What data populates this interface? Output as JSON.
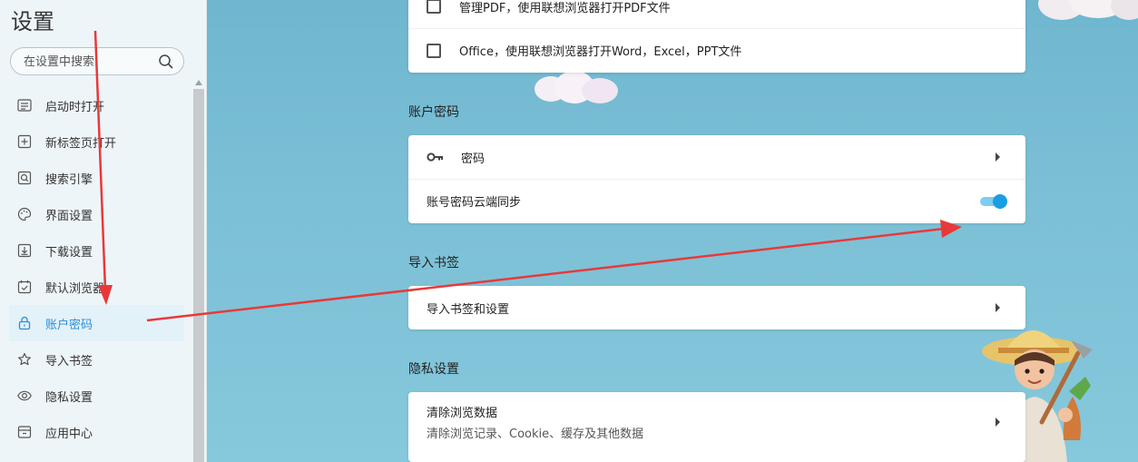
{
  "sidebar": {
    "title": "设置",
    "search_placeholder": "在设置中搜索",
    "items": [
      {
        "label": "启动时打开",
        "icon": "startup-icon"
      },
      {
        "label": "新标签页打开",
        "icon": "new-tab-icon"
      },
      {
        "label": "搜索引擎",
        "icon": "search-engine-icon"
      },
      {
        "label": "界面设置",
        "icon": "palette-icon"
      },
      {
        "label": "下载设置",
        "icon": "download-icon"
      },
      {
        "label": "默认浏览器",
        "icon": "default-browser-icon"
      },
      {
        "label": "账户密码",
        "icon": "lock-icon",
        "active": true
      },
      {
        "label": "导入书签",
        "icon": "star-icon"
      },
      {
        "label": "隐私设置",
        "icon": "eye-icon"
      },
      {
        "label": "应用中心",
        "icon": "app-center-icon"
      }
    ]
  },
  "main": {
    "pdf_card": {
      "row1": "管理PDF，使用联想浏览器打开PDF文件",
      "row2": "Office，使用联想浏览器打开Word，Excel，PPT文件"
    },
    "account": {
      "title": "账户密码",
      "password_label": "密码",
      "sync_label": "账号密码云端同步",
      "sync_enabled": true
    },
    "bookmarks": {
      "title": "导入书签",
      "import_label": "导入书签和设置"
    },
    "privacy": {
      "title": "隐私设置",
      "clear_label": "清除浏览数据",
      "clear_sub": "清除浏览记录、Cookie、缓存及其他数据"
    }
  },
  "colors": {
    "accent": "#2b8fd6",
    "toggle_on": "#1a9ee2",
    "annotation_arrow": "#e8393a"
  }
}
